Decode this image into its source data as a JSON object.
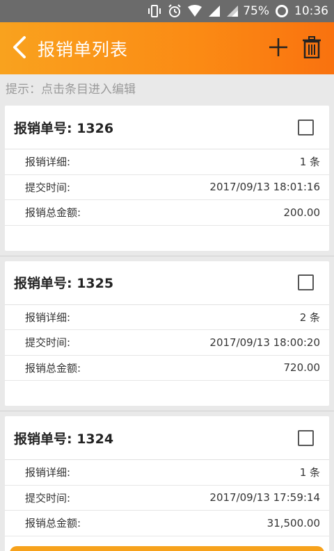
{
  "status": {
    "battery": "75%",
    "time": "10:36"
  },
  "header": {
    "title": "报销单列表"
  },
  "hint": "提示：点击条目进入编辑",
  "labels": {
    "detail": "报销详细:",
    "time": "提交时间:",
    "amount": "报销总金额:"
  },
  "items": [
    {
      "title": "报销单号: 1326",
      "detail": "1 条",
      "time": "2017/09/13 18:01:16",
      "amount": "200.00"
    },
    {
      "title": "报销单号: 1325",
      "detail": "2 条",
      "time": "2017/09/13 18:00:20",
      "amount": "720.00"
    },
    {
      "title": "报销单号: 1324",
      "detail": "1 条",
      "time": "2017/09/13 17:59:14",
      "amount": "31,500.00"
    }
  ],
  "colors": {
    "accent": "#fb8a14",
    "status_bar": "#6b6b6b"
  },
  "icons": {
    "back": "back-chevron-icon",
    "add": "plus-icon",
    "delete": "trash-icon"
  }
}
